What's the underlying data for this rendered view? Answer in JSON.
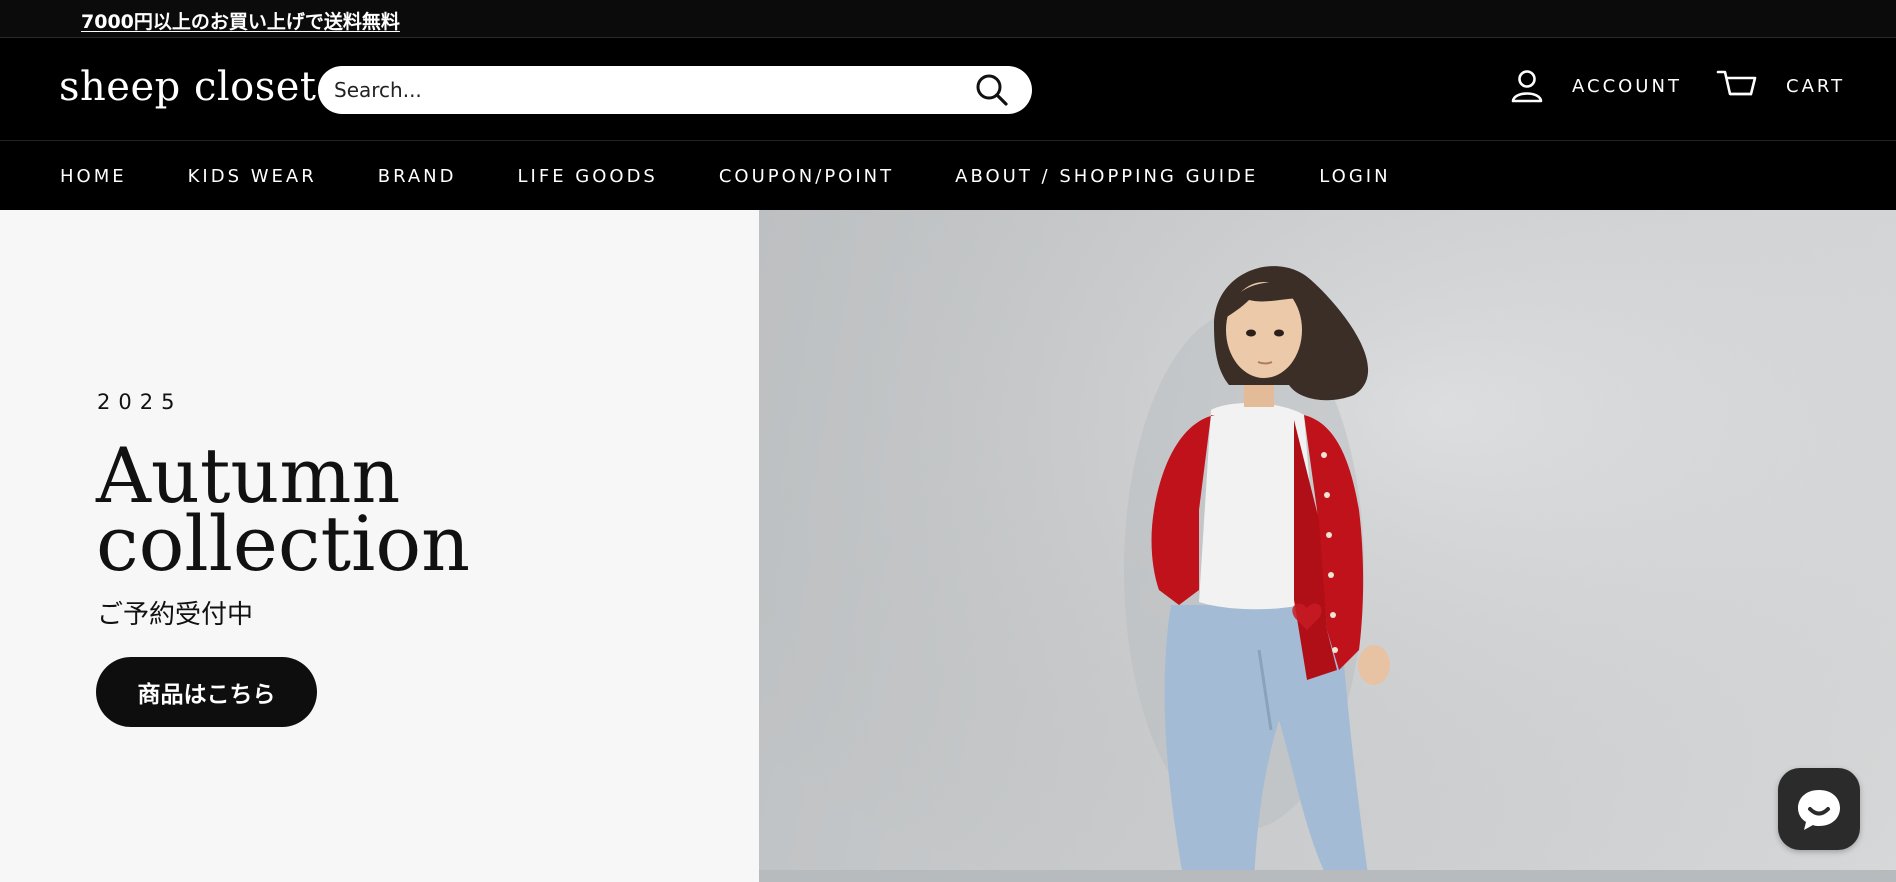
{
  "announcement": {
    "text": "7000円以上のお買い上げで送料無料"
  },
  "header": {
    "logo": "sheep closet",
    "search": {
      "placeholder": "Search..."
    },
    "account_label": "ACCOUNT",
    "cart_label": "CART"
  },
  "nav": {
    "items": [
      {
        "label": "HOME"
      },
      {
        "label": "KIDS WEAR"
      },
      {
        "label": "BRAND"
      },
      {
        "label": "LIFE GOODS"
      },
      {
        "label": "COUPON/POINT"
      },
      {
        "label": "ABOUT / SHOPPING GUIDE"
      },
      {
        "label": "LOGIN"
      }
    ]
  },
  "hero": {
    "year": "2025",
    "headline_line1": "Autumn",
    "headline_line2": "collection",
    "subline": "ご予約受付中",
    "cta_label": "商品はこちら",
    "image_alt": "Child in red cardigan and jeans leaning against a wall"
  },
  "colors": {
    "bar_bg": "#000000",
    "hero_left_bg": "#f7f7f7",
    "cardigan_red": "#c0121b",
    "denim": "#9fb8d2"
  },
  "icons": {
    "search": "search-icon",
    "account": "user-icon",
    "cart": "cart-icon",
    "chat": "chat-icon"
  }
}
